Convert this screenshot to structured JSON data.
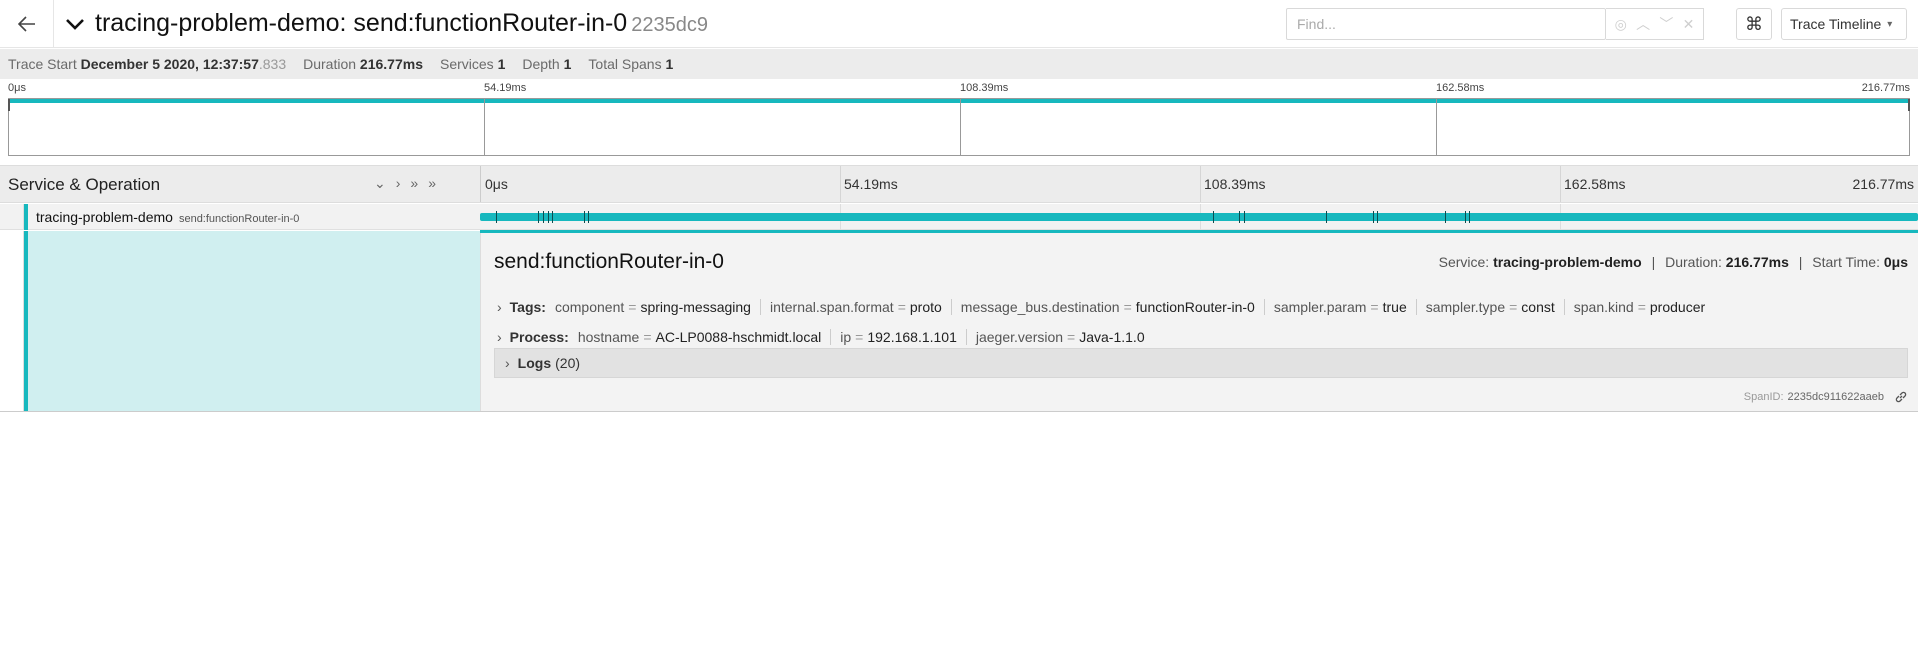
{
  "header": {
    "title": "tracing-problem-demo: send:functionRouter-in-0",
    "trace_id": "2235dc9",
    "find_placeholder": "Find...",
    "cmd_symbol": "⌘",
    "view_label": "Trace Timeline"
  },
  "summary": {
    "trace_start_label": "Trace Start",
    "trace_start_value": "December 5 2020, 12:37:57",
    "trace_start_ms": ".833",
    "duration_label": "Duration",
    "duration_value": "216.77ms",
    "services_label": "Services",
    "services_value": "1",
    "depth_label": "Depth",
    "depth_value": "1",
    "total_spans_label": "Total Spans",
    "total_spans_value": "1"
  },
  "ticks": [
    "0μs",
    "54.19ms",
    "108.39ms",
    "162.58ms",
    "216.77ms"
  ],
  "timeline": {
    "column_title": "Service & Operation"
  },
  "span": {
    "service": "tracing-problem-demo",
    "operation": "send:functionRouter-in-0",
    "log_positions_fraction": [
      0.011,
      0.04,
      0.044,
      0.047,
      0.05,
      0.072,
      0.075,
      0.51,
      0.528,
      0.531,
      0.588,
      0.621,
      0.624,
      0.671,
      0.685,
      0.688
    ]
  },
  "detail": {
    "title": "send:functionRouter-in-0",
    "service_label": "Service:",
    "service_value": "tracing-problem-demo",
    "duration_label": "Duration:",
    "duration_value": "216.77ms",
    "start_label": "Start Time:",
    "start_value": "0μs",
    "tags_label": "Tags:",
    "tags": [
      {
        "k": "component",
        "v": "spring-messaging"
      },
      {
        "k": "internal.span.format",
        "v": "proto"
      },
      {
        "k": "message_bus.destination",
        "v": "functionRouter-in-0"
      },
      {
        "k": "sampler.param",
        "v": "true"
      },
      {
        "k": "sampler.type",
        "v": "const"
      },
      {
        "k": "span.kind",
        "v": "producer"
      }
    ],
    "process_label": "Process:",
    "process": [
      {
        "k": "hostname",
        "v": "AC-LP0088-hschmidt.local"
      },
      {
        "k": "ip",
        "v": "192.168.1.101"
      },
      {
        "k": "jaeger.version",
        "v": "Java-1.1.0"
      }
    ],
    "logs_label": "Logs",
    "logs_count": "(20)",
    "span_id_label": "SpanID:",
    "span_id_value": "2235dc911622aaeb"
  },
  "colors": {
    "accent": "#17b8be",
    "detail_bg": "#d0eff0"
  }
}
